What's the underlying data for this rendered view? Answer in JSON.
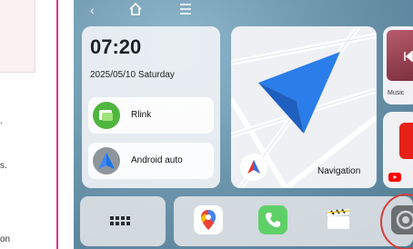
{
  "clock": {
    "time": "07:20",
    "date": "2025/05/10 Saturday"
  },
  "apps": [
    {
      "label": "Rlink"
    },
    {
      "label": "Android auto"
    }
  ],
  "navigation": {
    "label": "Navigation"
  },
  "music": {
    "label": "Music"
  },
  "colors": {
    "accent_divider": "#d4349c",
    "android_blue": "#4285f4",
    "phone_green": "#5fd068",
    "youtube_red": "#ff0000"
  },
  "icons": [
    "back-icon",
    "home-icon",
    "menu-icon",
    "app-grid-icon",
    "maps-icon",
    "phone-icon",
    "video-icon",
    "settings-icon"
  ]
}
